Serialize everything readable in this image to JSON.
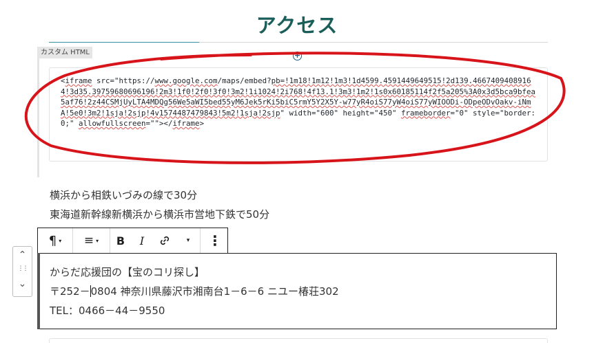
{
  "heading": {
    "title": "アクセス"
  },
  "html_block": {
    "label": "カスタム HTML",
    "inserter_symbol": "+",
    "code": "<iframe src=\"https://www.google.com/maps/embed?pb=!1m18!1m12!1m3!1d4599.4591449649515!2d139.46674094089164!3d35.39759680696196!2m3!1f0!2f0!3f0!3m2!1i1024!2i768!4f13.1!3m3!1m2!1s0x60185114f2f5a205%3A0x3d5bca9bfea5af76!2z44CSMjUyLTA4MDQg56We5aWI5bed55yM6Jek5rKi5biC5rmY5Y2X5Y-w77yR4oiS77yW4oiS77yWIOODi-ODpeODvOakv-iNmA!5e0!3m2!1sja!2sjp!4v1574487479843!5m2!1sja!2sjp\" width=\"600\" height=\"450\" frameborder=\"0\" style=\"border:0;\" allowfullscreen=\"\"></iframe>"
  },
  "access_text": {
    "line1": "横浜から相鉄いづみの線で30分",
    "line2": "東海道新幹線新横浜から横浜市営地下鉄で50分"
  },
  "mover": {
    "up": "⌃",
    "drag": "⋮⋮",
    "down": "⌄"
  },
  "toolbar": {
    "paragraph_icon": "¶",
    "align_icon": "≡",
    "bold": "B",
    "italic": "I",
    "link_icon": "🔗",
    "more_caret": "▾",
    "options_icon": "⋮",
    "caret": "▾"
  },
  "address_block": {
    "line1": "からだ応援団の【宝のコリ探し】",
    "line2_before": "〒252－",
    "line2_after": "0804 神奈川県藤沢市湘南台1－6－6 ニユー椿荘302",
    "line3": "TEL：0466－44－9550"
  },
  "colors": {
    "heading": "#1a5e5a",
    "annotation": "#d8141b",
    "toolbar_border": "#1e1e1e"
  }
}
